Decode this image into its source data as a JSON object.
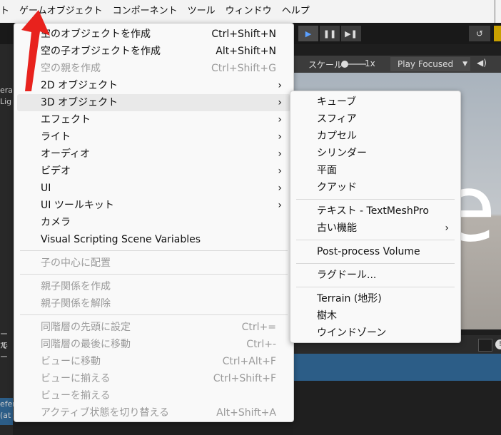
{
  "menubar": {
    "items": [
      "ト",
      "ゲームオブジェクト",
      "コンポーネント",
      "ツール",
      "ウィンドウ",
      "ヘルプ"
    ]
  },
  "toolbar": {
    "play_icon": "play-icon",
    "pause_icon": "pause-icon",
    "step_icon": "step-icon",
    "history_icon": "history-icon"
  },
  "left_panel": {
    "texts": [
      "era",
      "Lig",
      "ール",
      "でー",
      "efer",
      "(at"
    ]
  },
  "game_view": {
    "scale_label": "スケール",
    "zoom": "1x",
    "play_mode": "Play Focused",
    "audio_icon": "speaker-icon",
    "big_text": "e"
  },
  "gameobject_menu": {
    "items": [
      {
        "label": "空のオブジェクトを作成",
        "shortcut": "Ctrl+Shift+N",
        "enabled": true
      },
      {
        "label": "空の子オブジェクトを作成",
        "shortcut": "Alt+Shift+N",
        "enabled": true
      },
      {
        "label": "空の親を作成",
        "shortcut": "Ctrl+Shift+G",
        "enabled": false
      },
      {
        "label": "2D オブジェクト",
        "submenu": true,
        "enabled": true
      },
      {
        "label": "3D オブジェクト",
        "submenu": true,
        "enabled": true,
        "highlighted": true
      },
      {
        "label": "エフェクト",
        "submenu": true,
        "enabled": true
      },
      {
        "label": "ライト",
        "submenu": true,
        "enabled": true
      },
      {
        "label": "オーディオ",
        "submenu": true,
        "enabled": true
      },
      {
        "label": "ビデオ",
        "submenu": true,
        "enabled": true
      },
      {
        "label": "UI",
        "submenu": true,
        "enabled": true
      },
      {
        "label": "UI ツールキット",
        "submenu": true,
        "enabled": true
      },
      {
        "label": "カメラ",
        "enabled": true
      },
      {
        "label": "Visual Scripting Scene Variables",
        "enabled": true
      },
      {
        "label": "子の中心に配置",
        "enabled": false
      },
      {
        "label": "親子関係を作成",
        "enabled": false
      },
      {
        "label": "親子関係を解除",
        "enabled": false
      },
      {
        "label": "同階層の先頭に設定",
        "shortcut": "Ctrl+=",
        "enabled": false
      },
      {
        "label": "同階層の最後に移動",
        "shortcut": "Ctrl+-",
        "enabled": false
      },
      {
        "label": "ビューに移動",
        "shortcut": "Ctrl+Alt+F",
        "enabled": false
      },
      {
        "label": "ビューに揃える",
        "shortcut": "Ctrl+Shift+F",
        "enabled": false
      },
      {
        "label": "ビューを揃える",
        "enabled": false
      },
      {
        "label": "アクティブ状態を切り替える",
        "shortcut": "Alt+Shift+A",
        "enabled": false
      }
    ]
  },
  "object3d_submenu": {
    "items": [
      {
        "label": "キューブ"
      },
      {
        "label": "スフィア"
      },
      {
        "label": "カプセル"
      },
      {
        "label": "シリンダー"
      },
      {
        "label": "平面"
      },
      {
        "label": "クアッド"
      },
      {
        "label": "テキスト - TextMeshPro"
      },
      {
        "label": "古い機能",
        "submenu": true
      },
      {
        "label": "Post-process Volume"
      },
      {
        "label": "ラグドール..."
      },
      {
        "label": "Terrain (地形)"
      },
      {
        "label": "樹木"
      },
      {
        "label": "ウインドゾーン"
      }
    ]
  },
  "annotation": {
    "color": "#e8221d",
    "icon": "red-arrow"
  }
}
